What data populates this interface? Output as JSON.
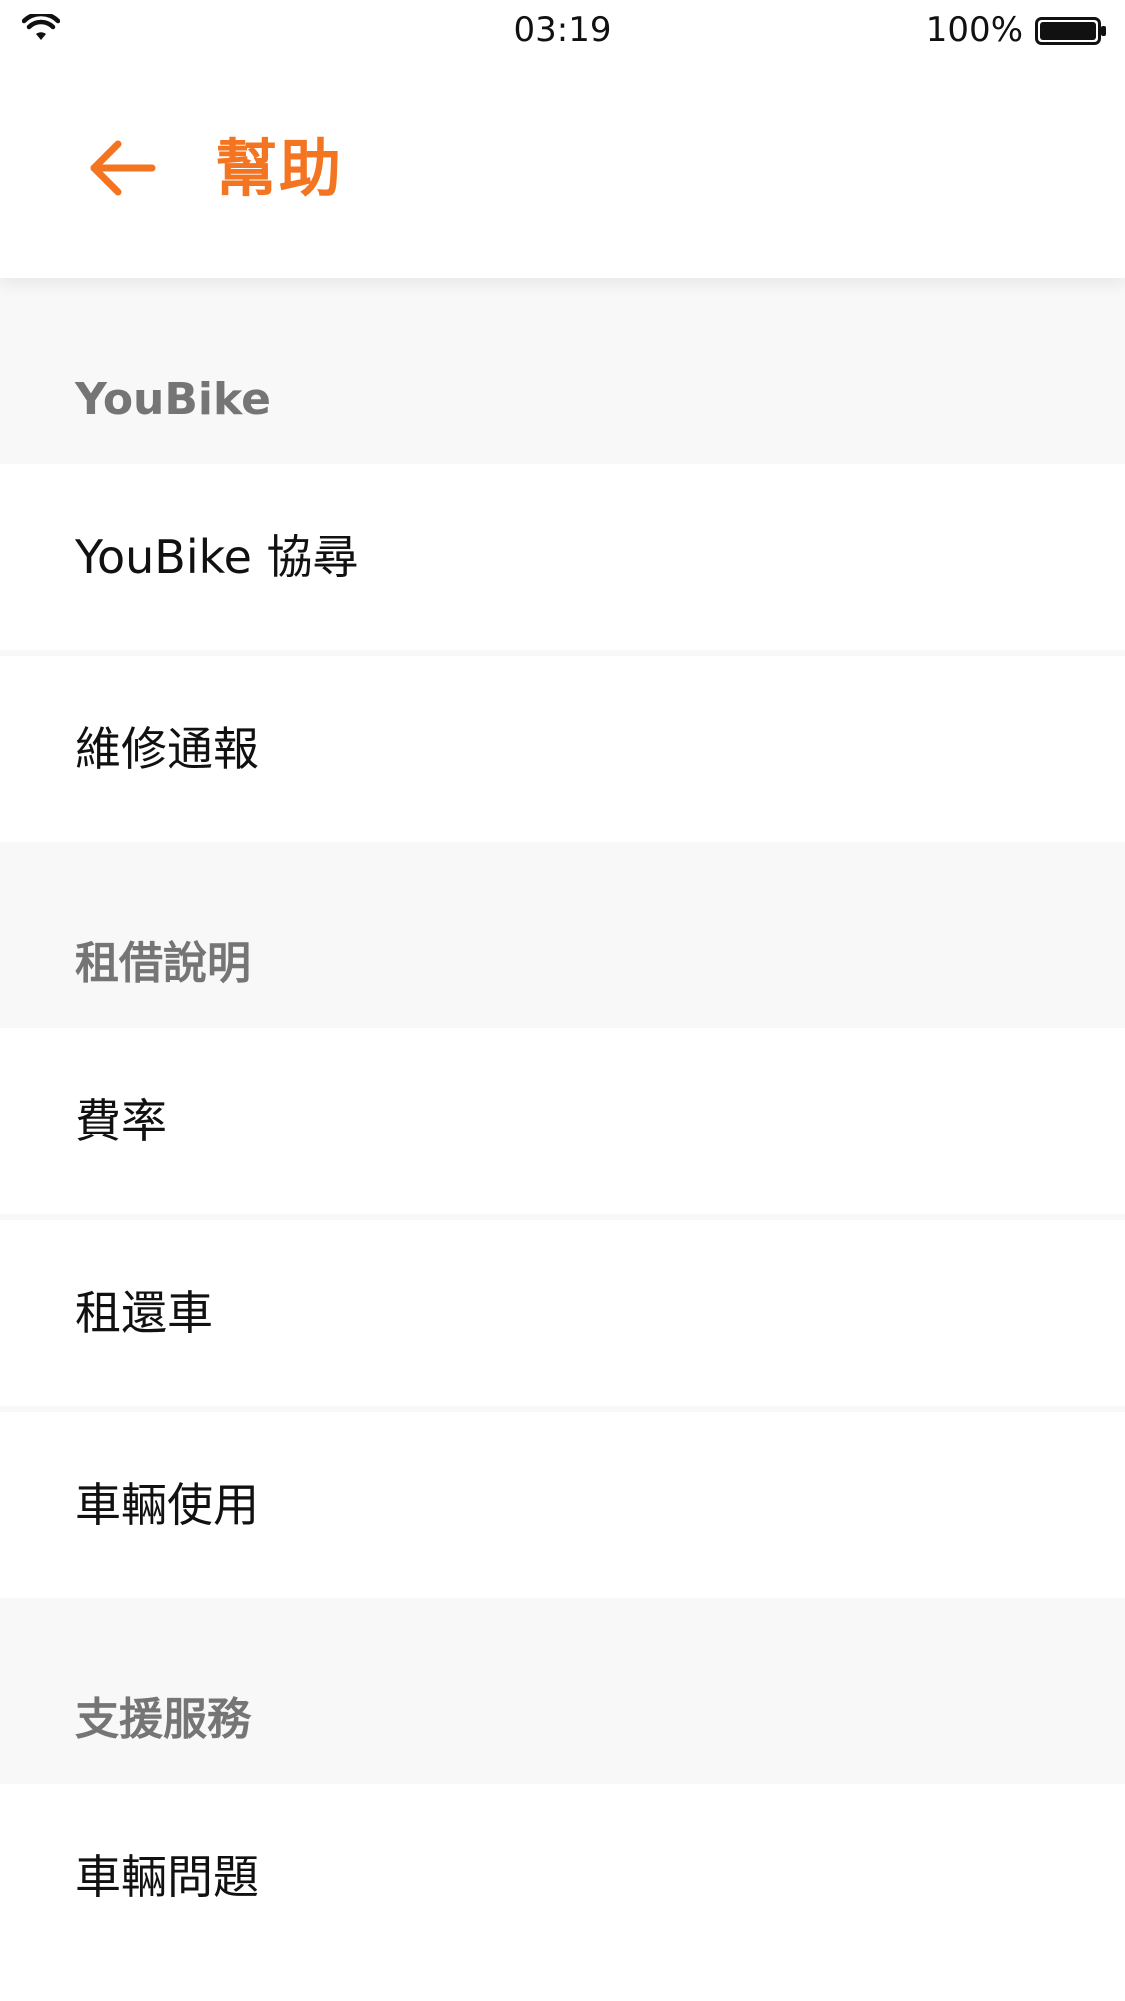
{
  "status_bar": {
    "time": "03:19",
    "battery_percent": "100%",
    "battery_level": 1.0
  },
  "header": {
    "title": "幫助",
    "back_icon": "arrow-left-icon",
    "accent_color": "#f37421"
  },
  "sections": [
    {
      "title": "YouBike",
      "items": [
        "YouBike 協尋",
        "維修通報"
      ]
    },
    {
      "title": "租借說明",
      "items": [
        "費率",
        "租還車",
        "車輛使用"
      ]
    },
    {
      "title": "支援服務",
      "items": [
        "車輛問題"
      ]
    }
  ]
}
